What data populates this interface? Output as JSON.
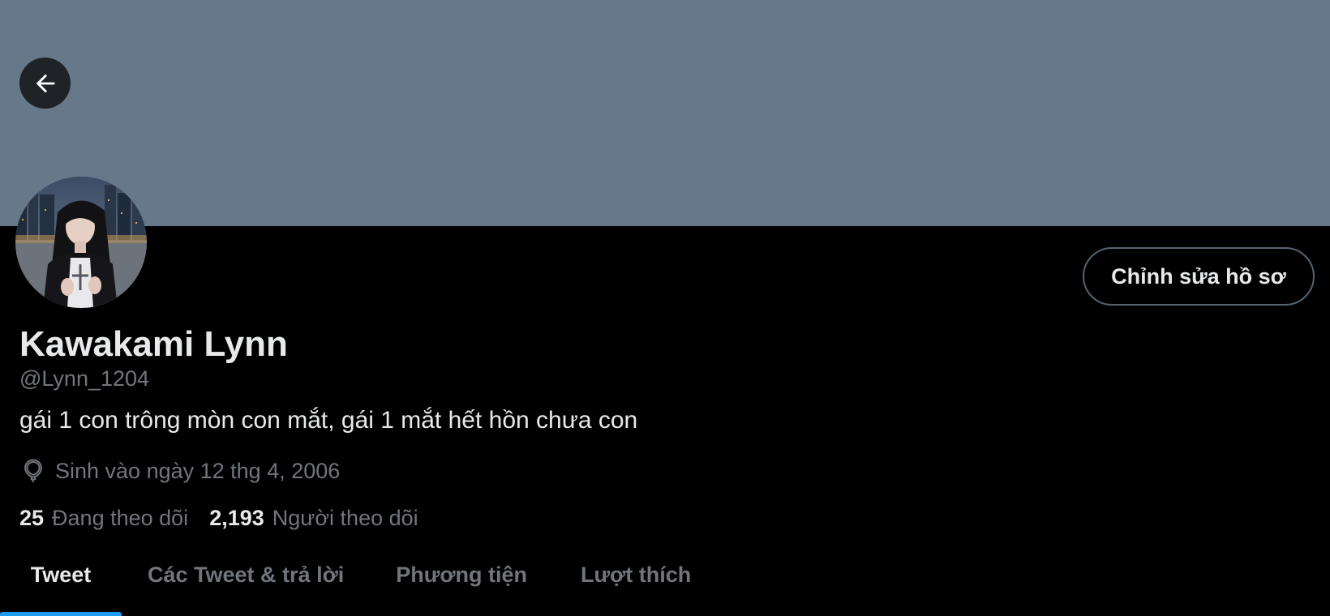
{
  "header": {
    "banner_color": "#66788a",
    "back_icon": "arrow-left-icon"
  },
  "profile": {
    "display_name": "Kawakami Lynn",
    "handle": "@Lynn_1204",
    "bio": "gái 1 con trông mòn con mắt, gái 1 mắt hết hồn chưa con",
    "birth_icon": "balloon-icon",
    "birth_text": "Sinh vào ngày 12 thg 4, 2006",
    "edit_button_label": "Chỉnh sửa hồ sơ"
  },
  "stats": {
    "following_count": "25",
    "following_label": "Đang theo dõi",
    "followers_count": "2,193",
    "followers_label": "Người theo dõi"
  },
  "tabs": [
    {
      "label": "Tweet",
      "active": true
    },
    {
      "label": "Các Tweet & trả lời",
      "active": false
    },
    {
      "label": "Phương tiện",
      "active": false
    },
    {
      "label": "Lượt thích",
      "active": false
    }
  ],
  "colors": {
    "accent": "#1d9bf0",
    "background": "#000000",
    "secondary_text": "#71767b",
    "primary_text": "#e7e9ea"
  }
}
